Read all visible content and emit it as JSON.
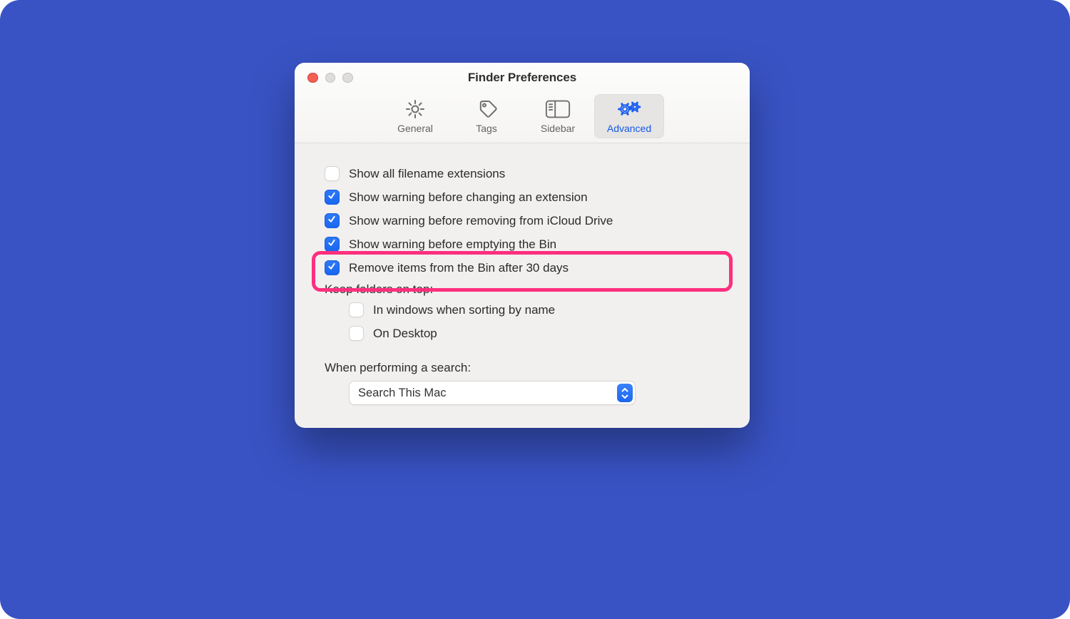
{
  "window": {
    "title": "Finder Preferences",
    "tabs": [
      {
        "label": "General",
        "icon": "gear-icon",
        "active": false
      },
      {
        "label": "Tags",
        "icon": "tag-icon",
        "active": false
      },
      {
        "label": "Sidebar",
        "icon": "sidebar-icon",
        "active": false
      },
      {
        "label": "Advanced",
        "icon": "gears-icon",
        "active": true
      }
    ]
  },
  "options": [
    {
      "label": "Show all filename extensions",
      "checked": false,
      "highlighted": false
    },
    {
      "label": "Show warning before changing an extension",
      "checked": true,
      "highlighted": false
    },
    {
      "label": "Show warning before removing from iCloud Drive",
      "checked": true,
      "highlighted": false
    },
    {
      "label": "Show warning before emptying the Bin",
      "checked": true,
      "highlighted": false
    },
    {
      "label": "Remove items from the Bin after 30 days",
      "checked": true,
      "highlighted": true
    }
  ],
  "keep_folders": {
    "label": "Keep folders on top:",
    "options": [
      {
        "label": "In windows when sorting by name",
        "checked": false
      },
      {
        "label": "On Desktop",
        "checked": false
      }
    ]
  },
  "search": {
    "label": "When performing a search:",
    "value": "Search This Mac"
  },
  "highlight_color": "#ff2f7e"
}
